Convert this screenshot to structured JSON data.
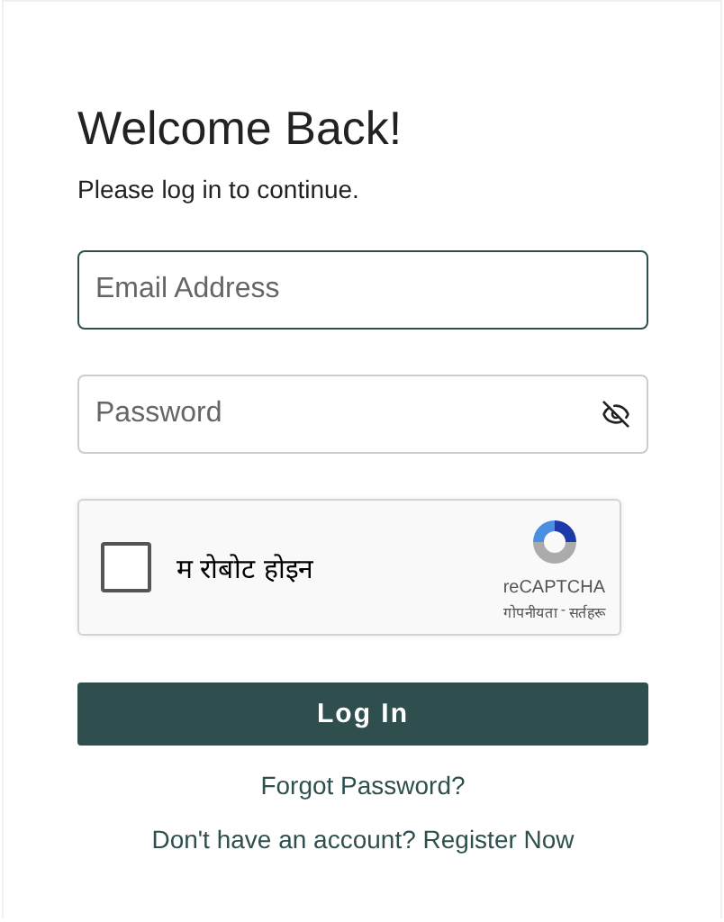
{
  "title": "Welcome Back!",
  "subtitle": "Please log in to continue.",
  "fields": [
    {
      "placeholder": "Email Address",
      "focused": true,
      "kind": "text"
    },
    {
      "placeholder": "Password",
      "focused": false,
      "kind": "password"
    }
  ],
  "captcha": {
    "label": "म रोबोट होइन",
    "checked": false,
    "brand": "reCAPTCHA",
    "privacy": "गोपनीयता",
    "separator": "-",
    "terms": "सर्तहरू"
  },
  "submit": "Log In",
  "forgot": "Forgot Password?",
  "register": "Don't have an account? Register Now"
}
